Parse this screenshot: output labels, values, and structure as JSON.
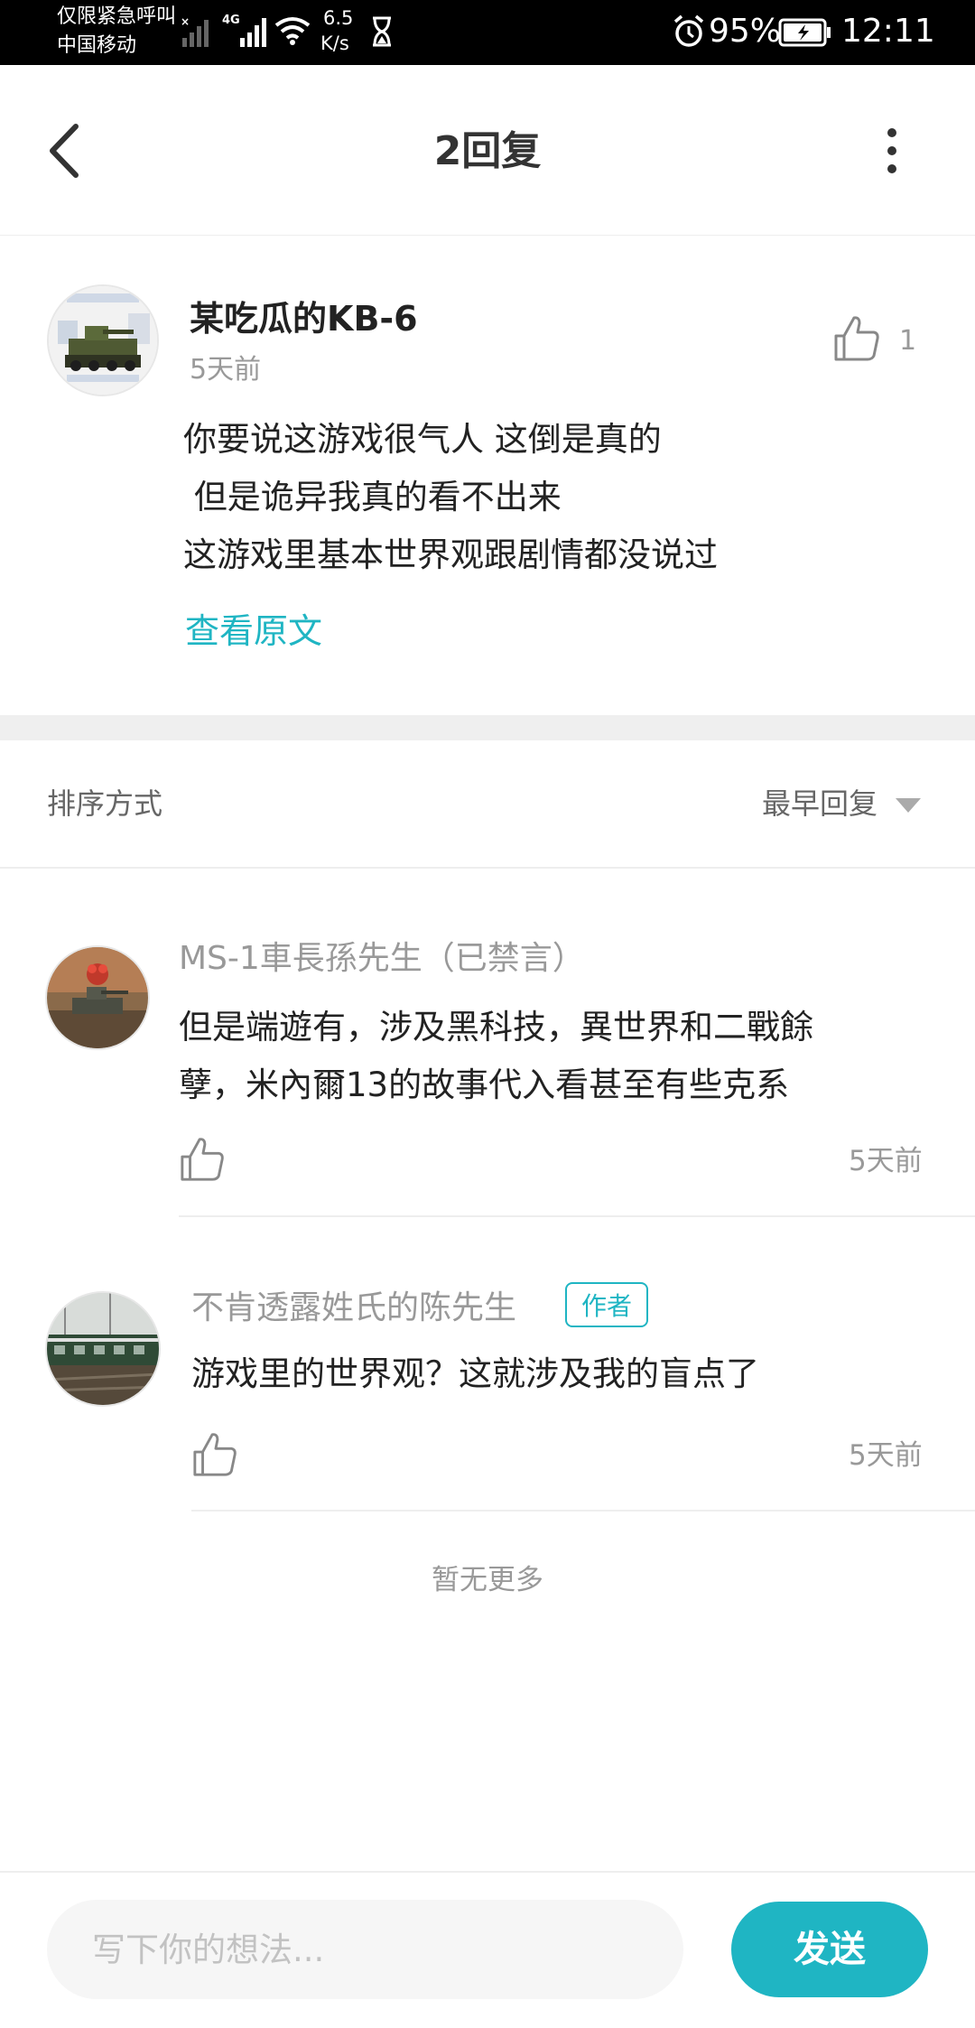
{
  "status_bar": {
    "carrier_line1": "仅限紧急呼叫",
    "carrier_line2": "中国移动",
    "network": "4G",
    "speed_value": "6.5",
    "speed_unit": "K/s",
    "battery_percent": "95%",
    "time": "12:11"
  },
  "header": {
    "title": "2回复"
  },
  "main_comment": {
    "author": "某吃瓜的KB-6",
    "time": "5天前",
    "like_count": "1",
    "text": "你要说这游戏很气人 这倒是真的\n 但是诡异我真的看不出来\n这游戏里基本世界观跟剧情都没说过",
    "view_original": "查看原文"
  },
  "sort": {
    "label": "排序方式",
    "value": "最早回复"
  },
  "replies": [
    {
      "author": "MS-1車長孫先生（已禁言）",
      "text": "但是端遊有，涉及黑科技，異世界和二戰餘\n孽，米內爾13的故事代入看甚至有些克系",
      "time": "5天前"
    },
    {
      "author": "不肯透露姓氏的陈先生",
      "badge": "作者",
      "text": "游戏里的世界观？这就涉及我的盲点了",
      "time": "5天前"
    }
  ],
  "no_more": "暂无更多",
  "input": {
    "placeholder": "写下你的想法..."
  },
  "send_label": "发送",
  "colors": {
    "accent": "#1fb5c3",
    "muted_text": "#999999",
    "status_bar": "#000000"
  }
}
